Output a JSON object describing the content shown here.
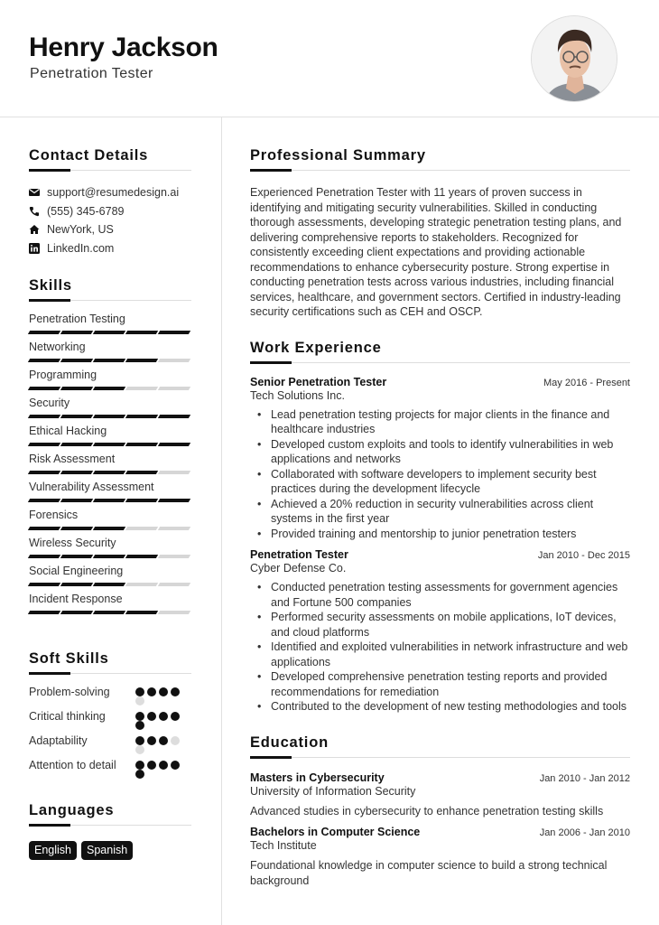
{
  "header": {
    "name": "Henry Jackson",
    "title": "Penetration Tester",
    "photo_alt": "Profile photo"
  },
  "contact": {
    "heading": "Contact Details",
    "items": [
      {
        "icon": "envelope-icon",
        "text": "support@resumedesign.ai"
      },
      {
        "icon": "phone-icon",
        "text": "(555) 345-6789"
      },
      {
        "icon": "home-icon",
        "text": "NewYork, US"
      },
      {
        "icon": "linkedin-icon",
        "text": "LinkedIn.com"
      }
    ]
  },
  "skills": {
    "heading": "Skills",
    "max": 5,
    "items": [
      {
        "label": "Penetration Testing",
        "level": 5
      },
      {
        "label": "Networking",
        "level": 4
      },
      {
        "label": "Programming",
        "level": 3
      },
      {
        "label": "Security",
        "level": 5
      },
      {
        "label": "Ethical Hacking",
        "level": 5
      },
      {
        "label": "Risk Assessment",
        "level": 4
      },
      {
        "label": "Vulnerability Assessment",
        "level": 5
      },
      {
        "label": "Forensics",
        "level": 3
      },
      {
        "label": "Wireless Security",
        "level": 4
      },
      {
        "label": "Social Engineering",
        "level": 3
      },
      {
        "label": "Incident Response",
        "level": 4
      }
    ]
  },
  "soft_skills": {
    "heading": "Soft Skills",
    "max": 5,
    "items": [
      {
        "label": "Problem-solving",
        "level": 4
      },
      {
        "label": "Critical thinking",
        "level": 5
      },
      {
        "label": "Adaptability",
        "level": 3
      },
      {
        "label": "Attention to detail",
        "level": 5
      }
    ]
  },
  "languages": {
    "heading": "Languages",
    "items": [
      "English",
      "Spanish"
    ]
  },
  "summary": {
    "heading": "Professional Summary",
    "text": "Experienced Penetration Tester with 11 years of proven success in identifying and mitigating security vulnerabilities. Skilled in conducting thorough assessments, developing strategic penetration testing plans, and delivering comprehensive reports to stakeholders. Recognized for consistently exceeding client expectations and providing actionable recommendations to enhance cybersecurity posture. Strong expertise in conducting penetration tests across various industries, including financial services, healthcare, and government sectors. Certified in industry-leading security certifications such as CEH and OSCP."
  },
  "experience": {
    "heading": "Work Experience",
    "jobs": [
      {
        "role": "Senior Penetration Tester",
        "date": "May 2016 - Present",
        "company": "Tech Solutions Inc.",
        "bullets": [
          "Lead penetration testing projects for major clients in the finance and healthcare industries",
          "Developed custom exploits and tools to identify vulnerabilities in web applications and networks",
          "Collaborated with software developers to implement security best practices during the development lifecycle",
          "Achieved a 20% reduction in security vulnerabilities across client systems in the first year",
          "Provided training and mentorship to junior penetration testers"
        ]
      },
      {
        "role": "Penetration Tester",
        "date": "Jan 2010 - Dec 2015",
        "company": "Cyber Defense Co.",
        "bullets": [
          "Conducted penetration testing assessments for government agencies and Fortune 500 companies",
          "Performed security assessments on mobile applications, IoT devices, and cloud platforms",
          "Identified and exploited vulnerabilities in network infrastructure and web applications",
          "Developed comprehensive penetration testing reports and provided recommendations for remediation",
          "Contributed to the development of new testing methodologies and tools"
        ]
      }
    ]
  },
  "education": {
    "heading": "Education",
    "items": [
      {
        "degree": "Masters in Cybersecurity",
        "date": "Jan 2010 - Jan 2012",
        "school": "University of Information Security",
        "desc": "Advanced studies in cybersecurity to enhance penetration testing skills"
      },
      {
        "degree": "Bachelors in Computer Science",
        "date": "Jan 2006 - Jan 2010",
        "school": "Tech Institute",
        "desc": "Foundational knowledge in computer science to build a strong technical background"
      }
    ]
  }
}
